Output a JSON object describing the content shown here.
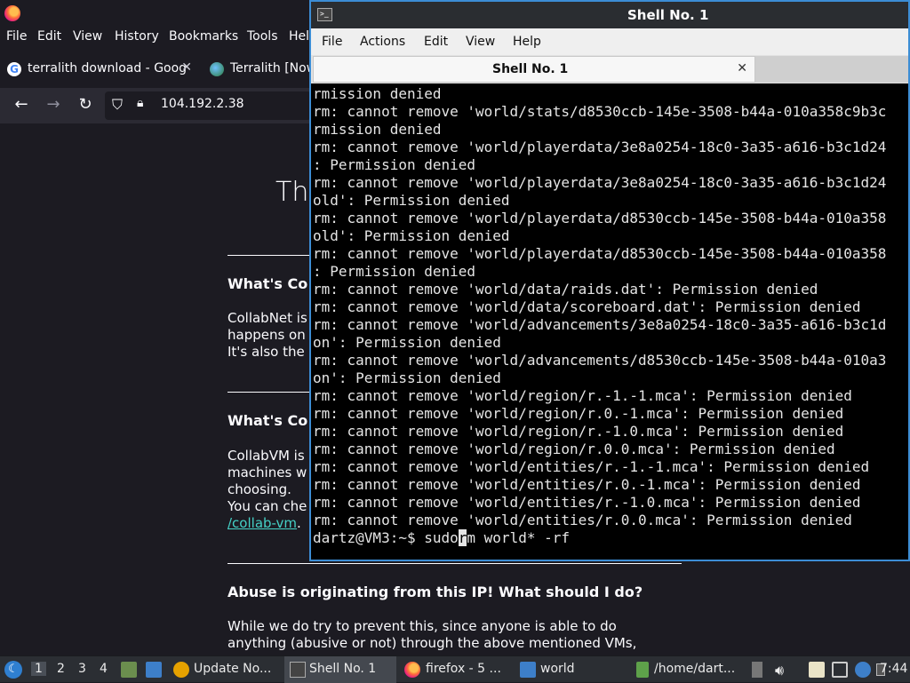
{
  "firefox": {
    "menu": [
      "File",
      "Edit",
      "View",
      "History",
      "Bookmarks",
      "Tools",
      "Hel"
    ],
    "tabs": [
      {
        "label": "terralith download - Goog"
      },
      {
        "label": "Terralith [Now"
      }
    ],
    "url": "104.192.2.38",
    "content": {
      "heading": "Thi",
      "h1": "What's Co",
      "p1": [
        "CollabNet is",
        "happens on",
        "It's also the"
      ],
      "h2": "What's Co",
      "p2": [
        "CollabVM is",
        "machines w",
        "choosing.",
        "You can che"
      ],
      "link": "/collab-vm",
      "link_suffix": ".",
      "h3": "Abuse is originating from this IP! What should I do?",
      "p3": [
        "While we do try to prevent this, since anyone is able to do",
        "anything (abusive or not) through the above mentioned VMs,"
      ]
    }
  },
  "terminal": {
    "title": "Shell No. 1",
    "menu": [
      "File",
      "Actions",
      "Edit",
      "View",
      "Help"
    ],
    "tab_label": "Shell No. 1",
    "lines": [
      "rmission denied",
      "rm: cannot remove 'world/stats/d8530ccb-145e-3508-b44a-010a358c9b3c",
      "rmission denied",
      "rm: cannot remove 'world/playerdata/3e8a0254-18c0-3a35-a616-b3c1d24",
      ": Permission denied",
      "rm: cannot remove 'world/playerdata/3e8a0254-18c0-3a35-a616-b3c1d24",
      "old': Permission denied",
      "rm: cannot remove 'world/playerdata/d8530ccb-145e-3508-b44a-010a358",
      "old': Permission denied",
      "rm: cannot remove 'world/playerdata/d8530ccb-145e-3508-b44a-010a358",
      ": Permission denied",
      "rm: cannot remove 'world/data/raids.dat': Permission denied",
      "rm: cannot remove 'world/data/scoreboard.dat': Permission denied",
      "rm: cannot remove 'world/advancements/3e8a0254-18c0-3a35-a616-b3c1d",
      "on': Permission denied",
      "rm: cannot remove 'world/advancements/d8530ccb-145e-3508-b44a-010a3",
      "on': Permission denied",
      "rm: cannot remove 'world/region/r.-1.-1.mca': Permission denied",
      "rm: cannot remove 'world/region/r.0.-1.mca': Permission denied",
      "rm: cannot remove 'world/region/r.-1.0.mca': Permission denied",
      "rm: cannot remove 'world/region/r.0.0.mca': Permission denied",
      "rm: cannot remove 'world/entities/r.-1.-1.mca': Permission denied",
      "rm: cannot remove 'world/entities/r.0.-1.mca': Permission denied",
      "rm: cannot remove 'world/entities/r.-1.0.mca': Permission denied",
      "rm: cannot remove 'world/entities/r.0.0.mca': Permission denied"
    ],
    "prompt": {
      "before_cursor": "dartz@VM3:~$ sudo",
      "cursor_char": "r",
      "after_cursor": "m world* -rf"
    }
  },
  "taskbar": {
    "workspaces": [
      "1",
      "2",
      "3",
      "4"
    ],
    "items": [
      {
        "label": "Update No..."
      },
      {
        "label": "Shell No. 1"
      },
      {
        "label": "firefox - 5 ..."
      },
      {
        "label": "world"
      },
      {
        "label": "/home/dart..."
      }
    ],
    "clock": "7:44"
  },
  "colors": {
    "accent": "#3c8dd5",
    "link": "#45d1c6"
  }
}
